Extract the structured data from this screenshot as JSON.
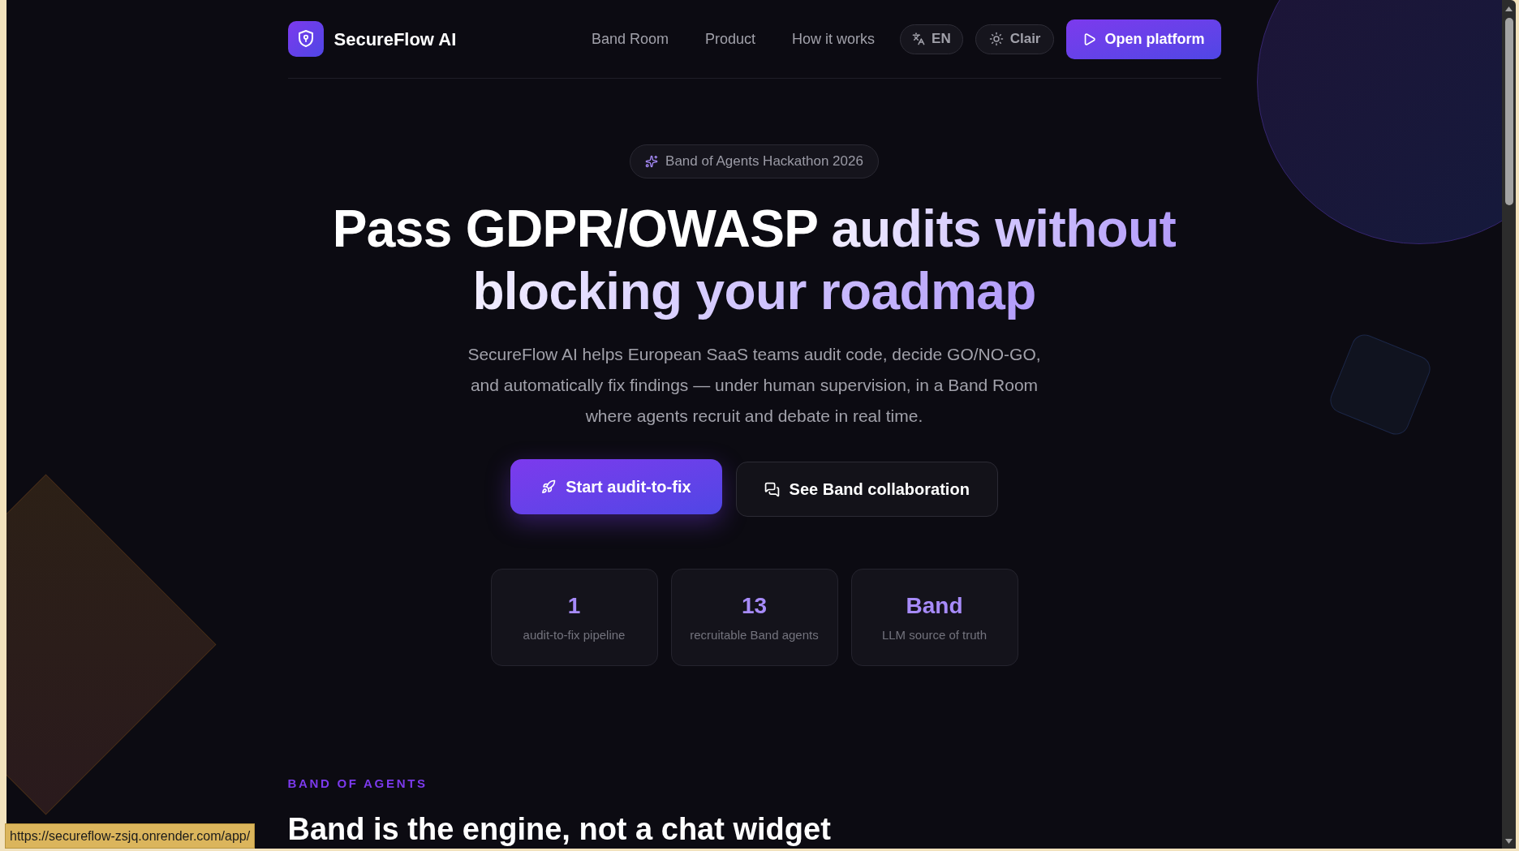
{
  "header": {
    "brand": "SecureFlow AI",
    "nav_links": [
      {
        "label": "Band Room"
      },
      {
        "label": "Product"
      },
      {
        "label": "How it works"
      }
    ],
    "language_toggle": "EN",
    "theme_toggle": "Clair",
    "cta": "Open platform"
  },
  "hero": {
    "badge": "Band of Agents Hackathon 2026",
    "title": {
      "lead": "Pass GDPR/OWASP",
      "highlight": "audits without blocking your roadmap"
    },
    "subtitle": "SecureFlow AI helps European SaaS teams audit code, decide GO/NO-GO, and automatically fix findings — under human supervision, in a Band Room where agents recruit and debate in real time.",
    "buttons": [
      {
        "label": "Start audit-to-fix",
        "kind": "primary"
      },
      {
        "label": "See Band collaboration",
        "kind": "secondary"
      }
    ],
    "stats": [
      {
        "value": "1",
        "label": "audit-to-fix pipeline"
      },
      {
        "value": "13",
        "label": "recruitable Band agents"
      },
      {
        "value": "Band",
        "label": "LLM source of truth"
      }
    ]
  },
  "section": {
    "eyebrow": "BAND OF AGENTS",
    "heading": "Band is the engine, not a chat widget"
  },
  "status_bar": {
    "url": "https://secureflow-zsjq.onrender.com/app/"
  }
}
